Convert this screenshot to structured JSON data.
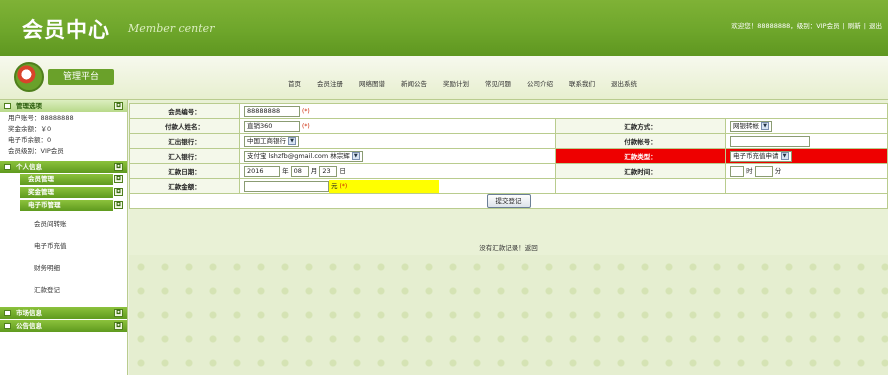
{
  "header": {
    "title": "会员中心",
    "subtitle": "Member center",
    "user_greeting": "欢迎您！88888888，级别：VIP会员",
    "refresh": "刷新",
    "logout": "退出"
  },
  "nav": {
    "brand": "管理平台",
    "items": [
      "首页",
      "会员注册",
      "网络图谱",
      "新闻公告",
      "奖励计划",
      "常见问题",
      "公司介绍",
      "联系我们",
      "退出系统"
    ]
  },
  "sidebar": {
    "menu_title": "管理选项",
    "info": [
      "用户账号：88888888",
      "奖金余额：￥0",
      "电子币余额：0",
      "会员级别：VIP会员"
    ],
    "personal": "个人信息",
    "member_mgmt": "会员管理",
    "bonus_mgmt": "奖金管理",
    "ecoin_mgmt": "电子币管理",
    "ecoin_links": [
      "会员间转账",
      "电子币充值",
      "财务明细",
      "汇款登记"
    ],
    "market": "市场信息",
    "notice": "公告信息",
    "toggle": "◘"
  },
  "form": {
    "member_no_label": "会员编号：",
    "member_no_value": "88888888",
    "payer_label": "付款人姓名：",
    "payer_value": "直销360",
    "remit_method_label": "汇款方式：",
    "remit_method_value": "网银转帐",
    "remit_bank_label": "汇出银行：",
    "remit_bank_value": "中国工商银行",
    "pay_account_label": "付款帐号：",
    "in_bank_label": "汇入银行：",
    "in_bank_value": "支付宝 lshzfb@gmail.com 林宗辉",
    "remit_type_label": "汇款类型：",
    "remit_type_value": "电子币充值申请",
    "remit_date_label": "汇款日期：",
    "date_year": "2016",
    "date_month": "08",
    "date_day": "23",
    "year_unit": "年",
    "month_unit": "月",
    "day_unit": "日",
    "remit_time_label": "汇款时间：",
    "hour_unit": "时",
    "minute_unit": "分",
    "amount_label": "汇款金额：",
    "amount_unit": "元",
    "required": "(*)",
    "submit": "提交登记"
  },
  "status": "没有汇款记录！返回",
  "colors": {
    "header_green": "#6ea62b",
    "alert_red": "#ee0000",
    "highlight_yellow": "#ffff00"
  }
}
